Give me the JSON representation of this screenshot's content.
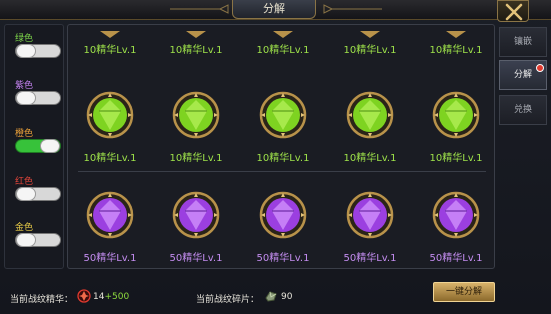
{
  "window": {
    "title": "分解"
  },
  "filters": [
    {
      "label": "绿色",
      "color": "#7cd44a",
      "enabled": false
    },
    {
      "label": "紫色",
      "color": "#c483f0",
      "enabled": false
    },
    {
      "label": "橙色",
      "color": "#f0a43a",
      "enabled": true
    },
    {
      "label": "红色",
      "color": "#e0453a",
      "enabled": false
    },
    {
      "label": "金色",
      "color": "#e8cc48",
      "enabled": false
    }
  ],
  "grid": {
    "top_row_labels": [
      "10精华Lv.1",
      "10精华Lv.1",
      "10精华Lv.1",
      "10精华Lv.1",
      "10精华Lv.1"
    ],
    "green_row_labels": [
      "10精华Lv.1",
      "10精华Lv.1",
      "10精华Lv.1",
      "10精华Lv.1",
      "10精华Lv.1"
    ],
    "purple_row_labels": [
      "50精华Lv.1",
      "50精华Lv.1",
      "50精华Lv.1",
      "50精华Lv.1",
      "50精华Lv.1"
    ]
  },
  "side_tabs": [
    {
      "label": "镶嵌",
      "active": false
    },
    {
      "label": "分解",
      "active": true,
      "badge": true
    },
    {
      "label": "兑换",
      "active": false
    }
  ],
  "bottom": {
    "essence_label": "当前战纹精华：",
    "essence_value": "14",
    "essence_gain": "+500",
    "shards_label": "当前战纹碎片：",
    "shards_value": "90",
    "decompose_all_label": "一键分解"
  },
  "colors": {
    "green_gem": "#7ed321",
    "purple_gem": "#9b3fe0",
    "gold_frame": "#b8924a",
    "accent_gold": "#d8b26a"
  }
}
